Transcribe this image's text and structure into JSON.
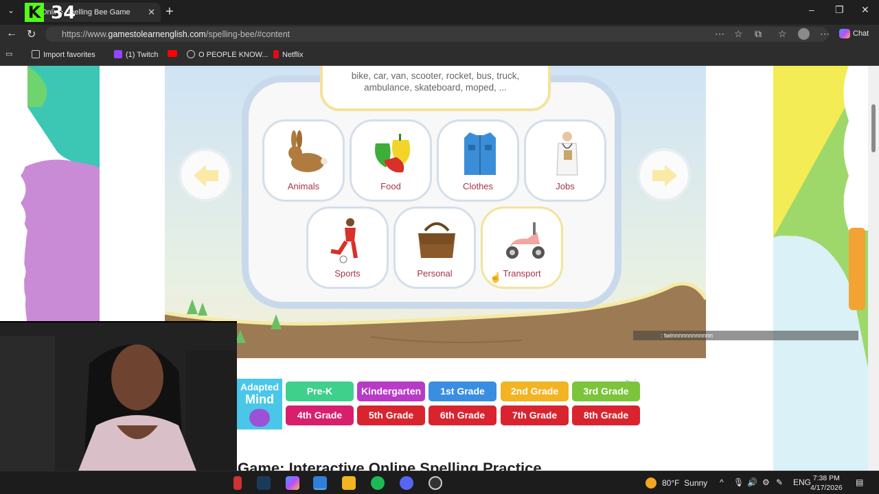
{
  "browser": {
    "tab_title": "Online Spelling Bee Game",
    "kick_overlay_number": "34",
    "url_prefix": "https://www.",
    "url_host": "gamestolearnenglish.com",
    "url_path": "/spelling-bee/#content",
    "chat_label": "Chat",
    "favorites": [
      {
        "label": "Import favorites"
      },
      {
        "label": "(1) Twitch"
      },
      {
        "label": ""
      },
      {
        "label": "O PEOPLE KNOW..."
      },
      {
        "label": "Netflix"
      }
    ]
  },
  "game": {
    "description_line1": "bike, car, van, scooter, rocket, bus, truck,",
    "description_line2": "ambulance, skateboard, moped, ...",
    "categories": [
      {
        "label": "Animals",
        "icon": "rabbit-icon"
      },
      {
        "label": "Food",
        "icon": "peppers-icon"
      },
      {
        "label": "Clothes",
        "icon": "shirt-icon"
      },
      {
        "label": "Jobs",
        "icon": "doctor-icon"
      },
      {
        "label": "Sports",
        "icon": "footballer-icon"
      },
      {
        "label": "Personal",
        "icon": "bag-icon"
      },
      {
        "label": "Transport",
        "icon": "scooter-icon",
        "selected": true
      }
    ],
    "arrow_color": "#fbe9a6"
  },
  "ad": {
    "logo_line1": "Adapted",
    "logo_line2": "Mind",
    "grades": [
      {
        "label": "Pre-K",
        "color": "#3fd08c"
      },
      {
        "label": "Kindergarten",
        "color": "#b83bc7"
      },
      {
        "label": "1st Grade",
        "color": "#3a8ee0"
      },
      {
        "label": "2nd Grade",
        "color": "#f2b422"
      },
      {
        "label": "3rd Grade",
        "color": "#7bc43b"
      },
      {
        "label": "4th Grade",
        "color": "#d81f6d"
      },
      {
        "label": "5th Grade",
        "color": "#d8242f"
      },
      {
        "label": "6th Grade",
        "color": "#d8242f"
      },
      {
        "label": "7th Grade",
        "color": "#d8242f"
      },
      {
        "label": "8th Grade",
        "color": "#d8242f"
      }
    ]
  },
  "page_heading": "Game: Interactive Online Spelling Practice",
  "chat_overlay_text": ": twinnnnnnnnnnnn",
  "taskbar": {
    "weather_temp": "80°F",
    "weather_desc": "Sunny",
    "lang": "ENG",
    "time": "7:38 PM",
    "date": "4/17/2026"
  }
}
